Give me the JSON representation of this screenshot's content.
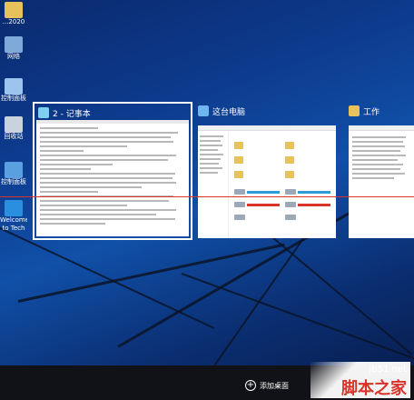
{
  "desktop_icons": [
    {
      "label": "...2020",
      "icon": "folder-icon"
    },
    {
      "label": "网络",
      "icon": "network-icon"
    },
    {
      "label": "控制面板",
      "icon": "control-panel-icon"
    },
    {
      "label": "回收站",
      "icon": "recycle-bin-icon"
    },
    {
      "label": "控制面板",
      "icon": "control-panel-icon"
    },
    {
      "label": "Welcome to Tech Previ...",
      "icon": "windows-icon"
    }
  ],
  "windows": [
    {
      "title": "2 - 记事本",
      "icon": "notepad-icon"
    },
    {
      "title": "这台电脑",
      "icon": "computer-icon"
    },
    {
      "title": "工作",
      "icon": "folder-icon"
    }
  ],
  "taskbar": {
    "add_desktop_label": "添加桌面"
  },
  "watermark": {
    "site": "jb51.net",
    "brand": "脚本之家"
  },
  "colors": {
    "selection_border": "#ffffff",
    "accent_red": "#d8342a",
    "folder_yellow": "#e7c25a",
    "taskbar": "#111217"
  }
}
